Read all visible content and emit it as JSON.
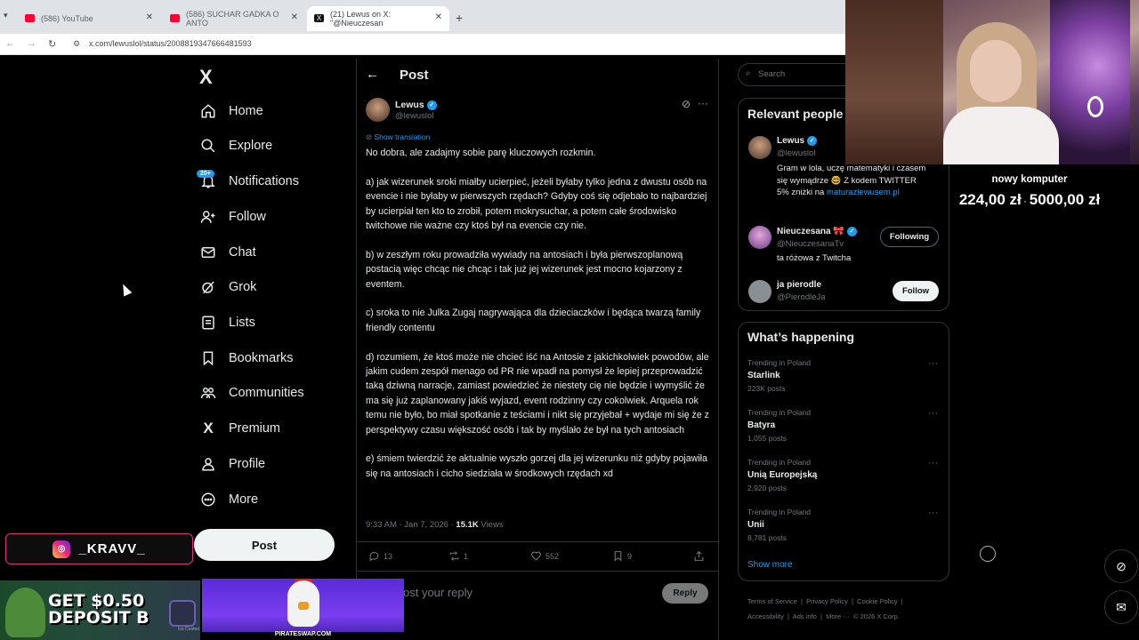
{
  "browser": {
    "tabs": [
      {
        "title": "(586) YouTube",
        "favicon": "youtube-icon",
        "active": false
      },
      {
        "title": "(586) SUCHAR GADKA O ANTO",
        "favicon": "youtube-icon",
        "active": false
      },
      {
        "title": "(21) Lewus on X: \"@Nieuczesan",
        "favicon": "x-icon",
        "active": true
      }
    ],
    "new_tab": "+",
    "url": "x.com/lewuslol/status/2008819347666481593"
  },
  "nav": {
    "logo": "X",
    "items": [
      {
        "label": "Home",
        "icon": "home-icon"
      },
      {
        "label": "Explore",
        "icon": "search-icon"
      },
      {
        "label": "Notifications",
        "icon": "bell-icon"
      },
      {
        "label": "Follow",
        "icon": "add-user-icon"
      },
      {
        "label": "Chat",
        "icon": "mail-icon"
      },
      {
        "label": "Grok",
        "icon": "grok-icon"
      },
      {
        "label": "Lists",
        "icon": "list-icon"
      },
      {
        "label": "Bookmarks",
        "icon": "bookmark-icon"
      },
      {
        "label": "Communities",
        "icon": "communities-icon"
      },
      {
        "label": "Premium",
        "icon": "x-icon"
      },
      {
        "label": "Profile",
        "icon": "profile-icon"
      },
      {
        "label": "More",
        "icon": "more-circle-icon"
      }
    ],
    "notifications_badge": "20+",
    "post_button": "Post"
  },
  "post": {
    "header_title": "Post",
    "author_name": "Lewus",
    "author_handle": "@lewuslol",
    "show_translation": "Show translation",
    "paragraphs": [
      "No dobra, ale zadajmy sobie parę kluczowych rozkmin.",
      "a) jak wizerunek sroki miałby ucierpieć, jeżeli byłaby tylko jedna z dwustu osób na evencie i nie byłaby w pierwszych rzędach? Gdyby coś się odjebało to najbardziej by ucierpiał ten kto to zrobił, potem mokrysuchar, a potem całe środowisko twitchowe nie ważne czy ktoś był na evencie czy nie.",
      "b) w zeszłym roku prowadziła wywiady na antosiach i była pierwszoplanową postacią więc chcąc nie chcąc i tak już jej wizerunek jest mocno kojarzony z eventem.",
      "c) sroka to nie Julka Zugaj nagrywająca dla dzieciaczków i będąca twarzą family friendly contentu",
      "d) rozumiem, że ktoś może nie chcieć iść na Antosie z jakichkolwiek powodów, ale jakim cudem zespół menago od PR nie wpadł na pomysł że lepiej przeprowadzić taką dziwną narracje, zamiast powiedzieć że niestety cię nie będzie i wymyślić że ma się już zaplanowany jakiś wyjazd, event rodzinny czy cokolwiek. Arquela rok temu nie było, bo miał spotkanie z teściami i nikt się przyjebał + wydaje mi się że z perspektywy czasu większość osób i tak by myślało że był na tych antosiach",
      "e) śmiem twierdzić że aktualnie wyszło gorzej dla jej wizerunku niż gdyby pojawiła się na antosiach i cicho siedziała w środkowych rzędach xd"
    ],
    "timestamp": "9:33 AM · Jan 7, 2026 · ",
    "views_count": "15.1K",
    "views_label": " Views",
    "replies": "13",
    "reposts": "1",
    "likes": "552",
    "bookmarks": "9",
    "reply_placeholder": "ost your reply",
    "reply_button": "Reply"
  },
  "sidebar_right": {
    "search_placeholder": "Search",
    "relevant_title": "Relevant people",
    "people": [
      {
        "name": "Lewus",
        "handle": "@lewuslol",
        "bio": "Gram w lola, uczę matematyki i czasem się wymądrze 🤓 Z kodem TWITTER 5% zniżki na ",
        "bio_link": "maturazlewusem.pl",
        "button": ""
      },
      {
        "name": "Nieuczesana 🎀",
        "handle": "@NieuczesanaTv",
        "bio": "ta różowa z Twitcha",
        "bio_link": "",
        "button": "Following"
      },
      {
        "name": "ja pierodle",
        "handle": "@PierodleJa",
        "bio": "",
        "bio_link": "",
        "button": "Follow"
      }
    ],
    "happening_title": "What’s happening",
    "trends": [
      {
        "context": "Trending in Poland",
        "name": "Starlink",
        "count": "223K posts"
      },
      {
        "context": "Trending in Poland",
        "name": "Batyra",
        "count": "1,055 posts"
      },
      {
        "context": "Trending in Poland",
        "name": "Unią Europejską",
        "count": "2,920 posts"
      },
      {
        "context": "Trending in Poland",
        "name": "Unii",
        "count": "8,781 posts"
      }
    ],
    "show_more": "Show more",
    "footer_links": [
      "Terms of Service",
      "Privacy Policy",
      "Cookie Policy",
      "Accessibility",
      "Ads info",
      "More ···",
      "© 2026 X Corp."
    ]
  },
  "overlay": {
    "goal_title": "nowy komputer",
    "goal_current": "224,00 zł",
    "goal_separator": "·",
    "goal_target": "5000,00 zł",
    "instagram_handle": "_KRAVV_",
    "ad_text_line1": "GET $0.50",
    "ad_text_line2": "DEPOSIT B",
    "ad_label": "Ice Cooled",
    "pirate_label": "PIRATESWAP.COM"
  }
}
